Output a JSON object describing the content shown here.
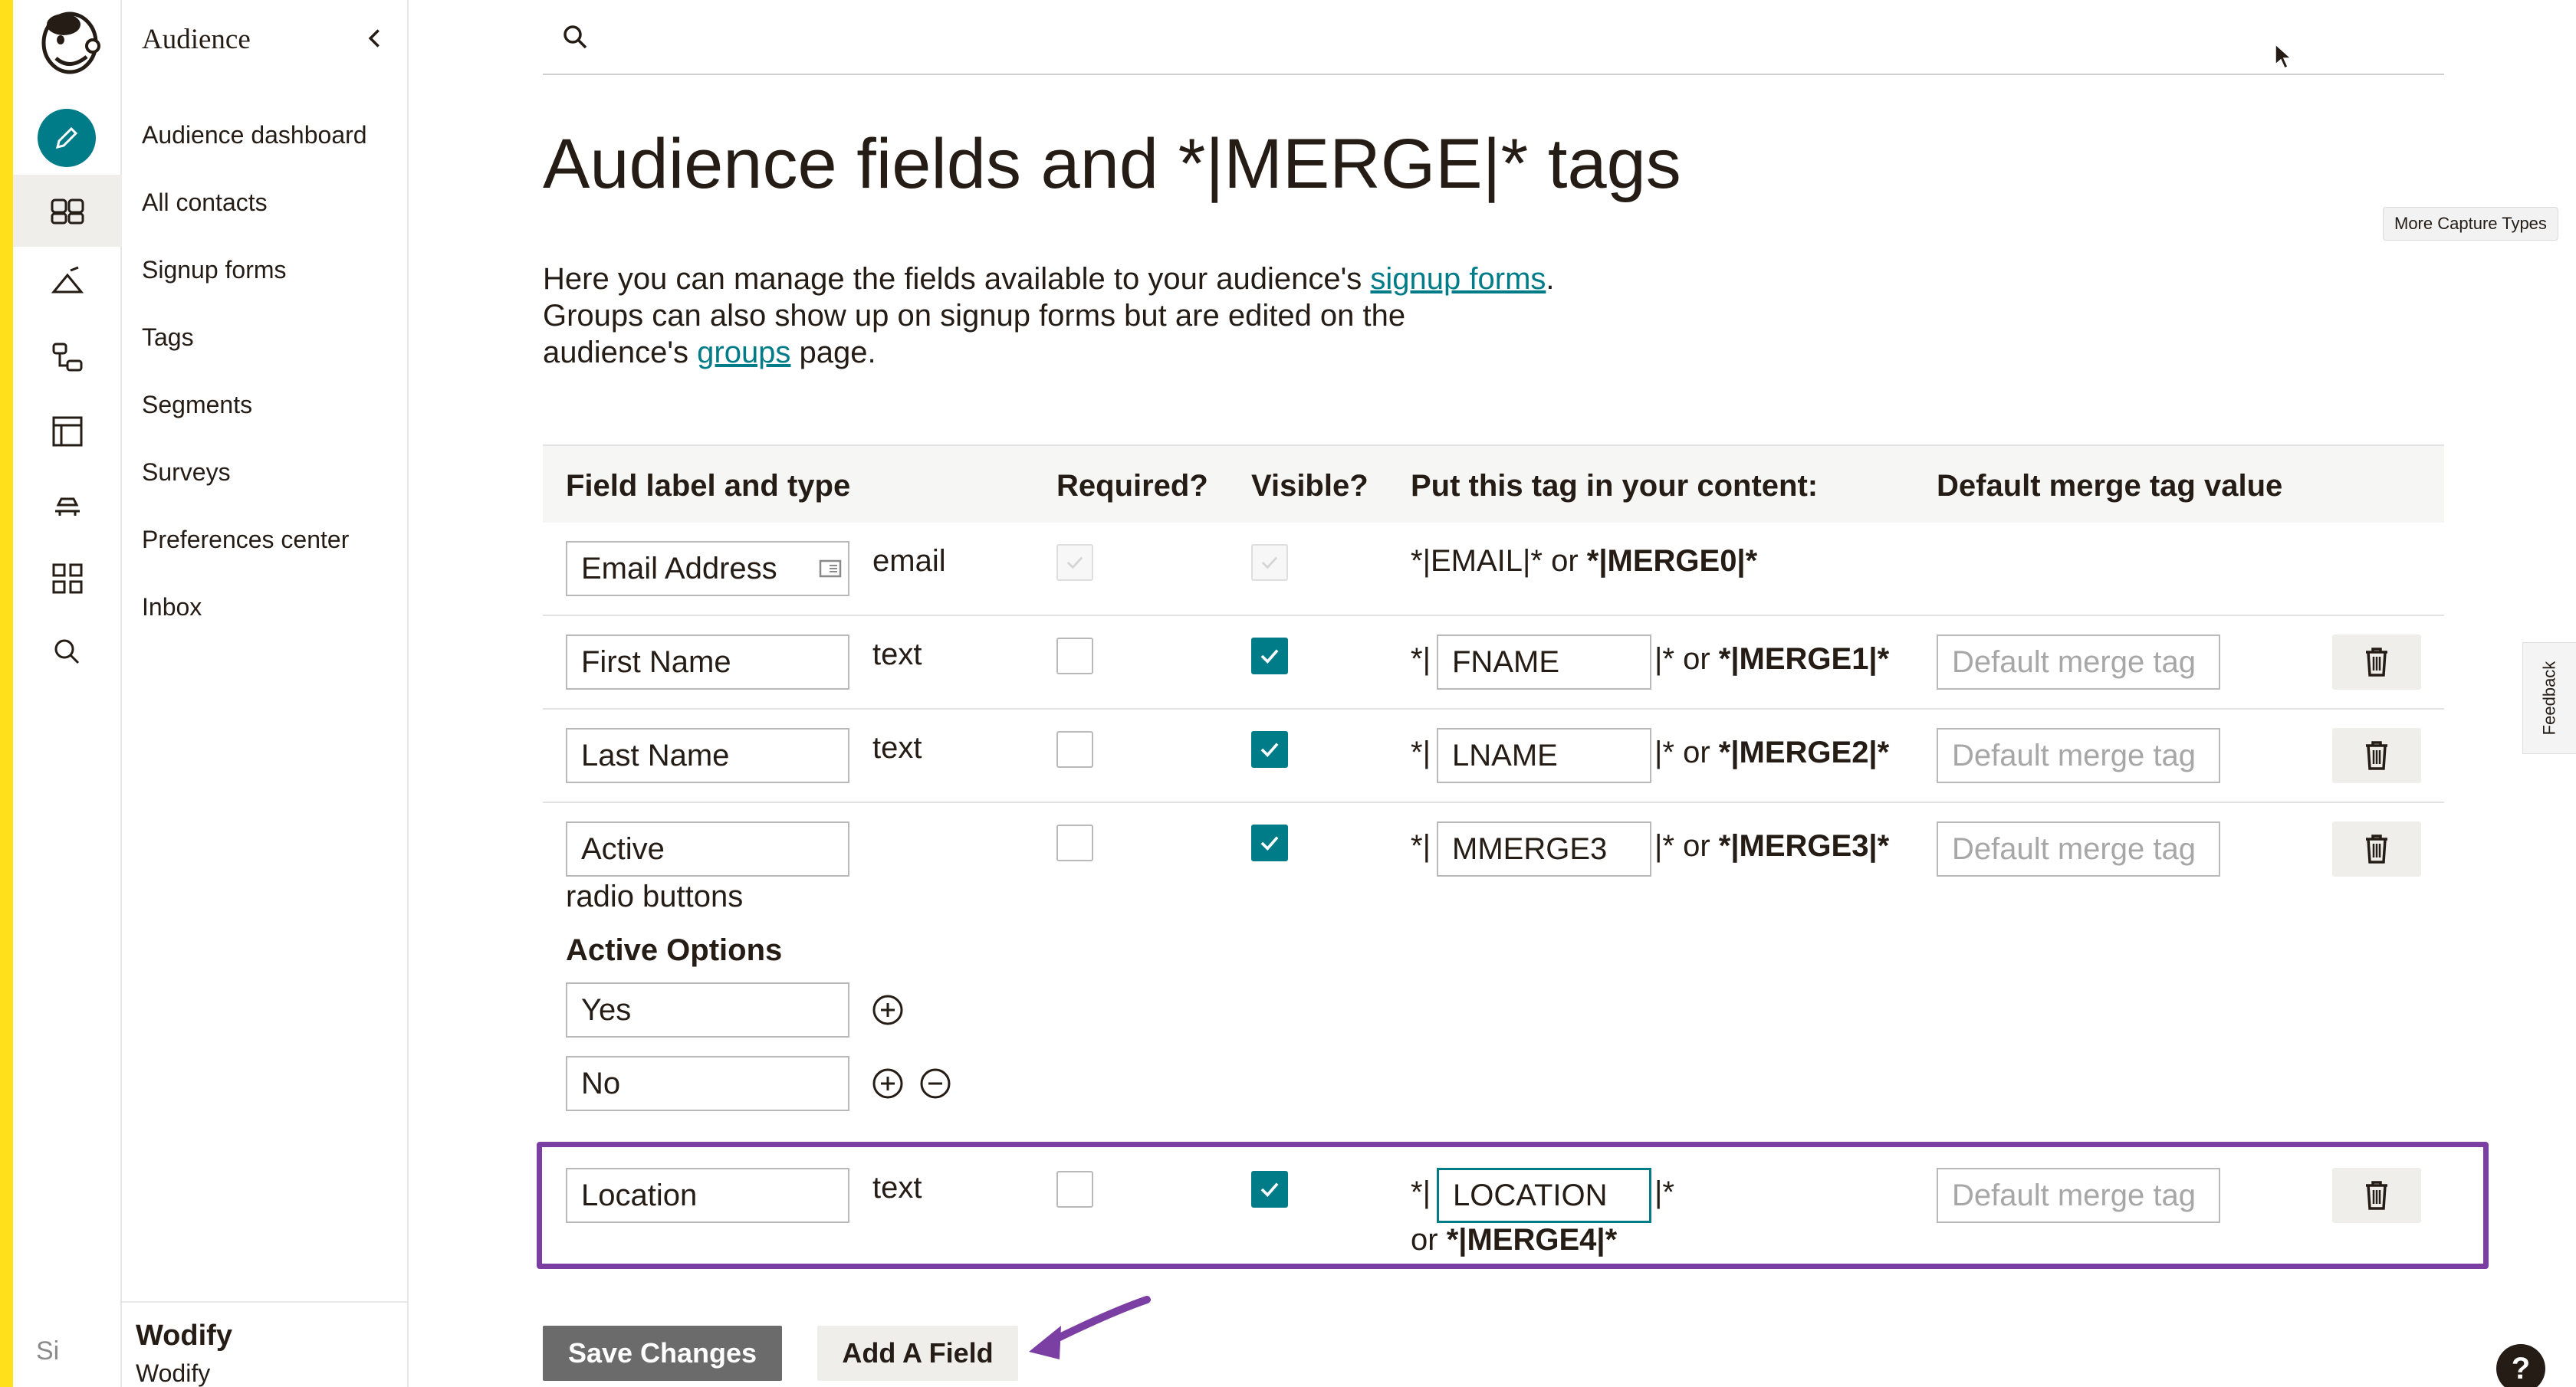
{
  "sidebar": {
    "title": "Audience",
    "items": [
      {
        "label": "Audience dashboard"
      },
      {
        "label": "All contacts"
      },
      {
        "label": "Signup forms"
      },
      {
        "label": "Tags"
      },
      {
        "label": "Segments"
      },
      {
        "label": "Surveys"
      },
      {
        "label": "Preferences center"
      },
      {
        "label": "Inbox"
      }
    ],
    "account_name": "Wodify",
    "account_sub": "Wodify",
    "avatar_alt": "Si"
  },
  "rail": {
    "icons": [
      "create-pencil-icon",
      "audience-icon",
      "campaigns-icon",
      "automations-icon",
      "website-icon",
      "integrations-icon",
      "apps-grid-icon",
      "search-icon"
    ],
    "accent": "#007c89"
  },
  "page": {
    "title": "Audience fields and *|MERGE|* tags",
    "intro_1": "Here you can manage the fields available to your audience's ",
    "intro_link_1": "signup forms",
    "intro_2": ".",
    "intro_3": "Groups can also show up on signup forms but are edited on the audience's ",
    "intro_link_2": "groups",
    "intro_4": " page.",
    "more_capture": "More Capture Types",
    "feedback": "Feedback"
  },
  "table": {
    "headers": [
      "Field label and type",
      "Required?",
      "Visible?",
      "Put this tag in your content:",
      "Default merge tag value"
    ],
    "rows": [
      {
        "label": "Email Address",
        "type": "email",
        "required": true,
        "visible": true,
        "locked": true,
        "tag_pre": "*|EMAIL|* or ",
        "merge": "*|MERGE0|*"
      },
      {
        "label": "First Name",
        "type": "text",
        "required": false,
        "visible": true,
        "tag": "FNAME",
        "tag_post": "|* or ",
        "merge": "*|MERGE1|*",
        "default_placeholder": "Default merge tag"
      },
      {
        "label": "Last Name",
        "type": "text",
        "required": false,
        "visible": true,
        "tag": "LNAME",
        "tag_post": "|* or ",
        "merge": "*|MERGE2|*",
        "default_placeholder": "Default merge tag"
      },
      {
        "label": "Active",
        "type": "radio buttons",
        "required": false,
        "visible": true,
        "tag": "MMERGE3",
        "tag_post": "|* or ",
        "merge": "*|MERGE3|*",
        "default_placeholder": "Default merge tag",
        "options_title": "Active Options",
        "options": [
          "Yes",
          "No"
        ]
      },
      {
        "label": "Location",
        "type": "text",
        "required": false,
        "visible": true,
        "tag": "LOCATION",
        "tag_post": "|*",
        "or_text": "or ",
        "merge": "*|MERGE4|*",
        "default_placeholder": "Default merge tag"
      }
    ],
    "tag_pre": "*|"
  },
  "actions": {
    "save": "Save Changes",
    "add": "Add A Field",
    "help": "?"
  },
  "colors": {
    "accent": "#007c89",
    "highlight": "#7b3ea3",
    "brand_yellow": "#ffe01b"
  }
}
